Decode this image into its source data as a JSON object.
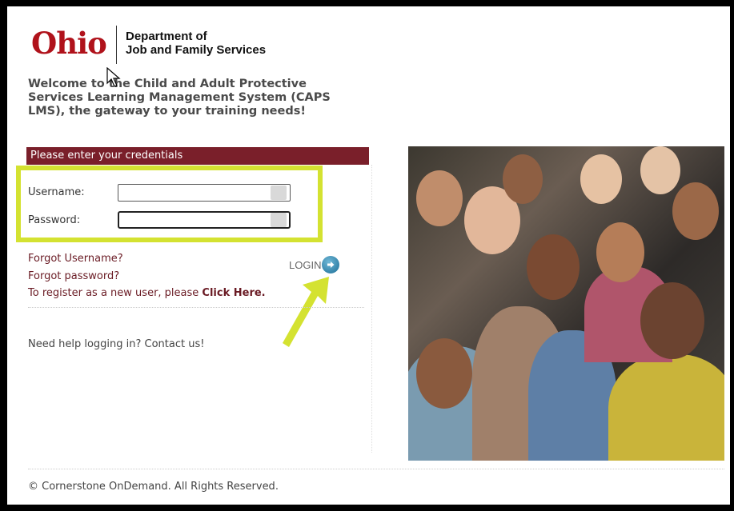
{
  "logo": {
    "brand": "Ohio",
    "dept_line1": "Department of",
    "dept_line2": "Job and Family Services"
  },
  "welcome": "Welcome to the Child and Adult Protective Services Learning Management System (CAPS LMS), the gateway to your training needs!",
  "login_panel": {
    "header": "Please enter your credentials",
    "username_label": "Username:",
    "username_value": "",
    "password_label": "Password:",
    "password_value": "",
    "forgot_username": "Forgot Username?",
    "forgot_password": "Forgot password?",
    "register_prefix": "To register as a new user, please ",
    "register_link": "Click Here.",
    "login_label": "LOGIN",
    "help": "Need help logging in? Contact us!"
  },
  "footer": "© Cornerstone OnDemand. All Rights Reserved.",
  "colors": {
    "brand_red": "#b0121b",
    "header_bar": "#7a1f2a",
    "highlight": "#d4e231",
    "login_icon": "#1c6e97"
  },
  "icons": {
    "login": "arrow-right-circle-icon",
    "autofill": "autofill-key-icon",
    "cursor": "mouse-pointer-icon",
    "annotation_arrow": "yellow-arrow-icon"
  }
}
